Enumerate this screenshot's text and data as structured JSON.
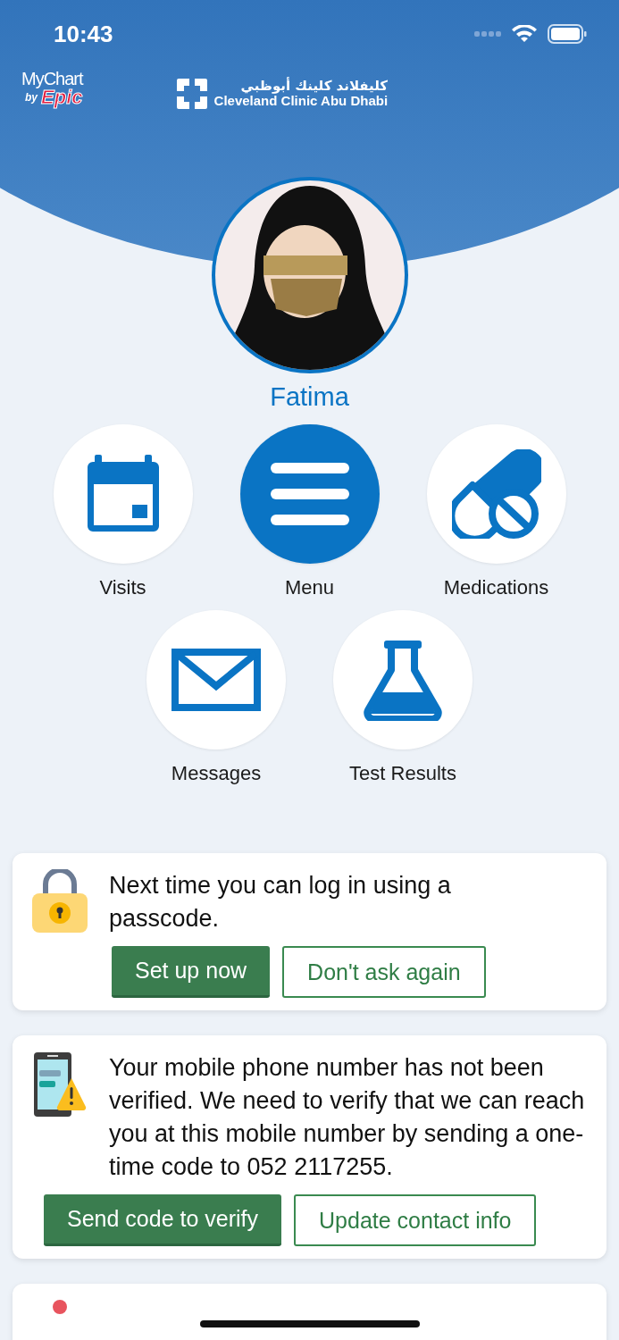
{
  "status_bar": {
    "time": "10:43"
  },
  "header": {
    "mychart_logo": {
      "name": "MyChart",
      "by": "by",
      "brand": "Epic"
    },
    "clinic_logo": {
      "arabic": "كليفلاند كلينك أبوظبي",
      "english": "Cleveland Clinic Abu Dhabi"
    }
  },
  "profile": {
    "name": "Fatima"
  },
  "shortcuts": [
    {
      "label": "Visits",
      "kind": "calendar",
      "selected": false
    },
    {
      "label": "Menu",
      "kind": "menu",
      "selected": true
    },
    {
      "label": "Medications",
      "kind": "pill",
      "selected": false
    },
    {
      "label": "Messages",
      "kind": "envelope",
      "selected": false
    },
    {
      "label": "Test Results",
      "kind": "flask",
      "selected": false
    }
  ],
  "cards": [
    {
      "kind": "lock",
      "text": "Next time you can log in using a passcode.",
      "buttons": [
        {
          "label": "Set up now",
          "kind": "primary"
        },
        {
          "label": "Don't ask again",
          "kind": "secondary"
        }
      ]
    },
    {
      "kind": "phone-warning",
      "text": "Your mobile phone number has not been verified. We need to verify that we can reach you at this mobile number by sending a one-time code to 052 2117255.",
      "buttons": [
        {
          "label": "Send code to verify",
          "kind": "primary"
        },
        {
          "label": "Update contact info",
          "kind": "secondary"
        }
      ]
    },
    {
      "kind": "pin"
    }
  ]
}
